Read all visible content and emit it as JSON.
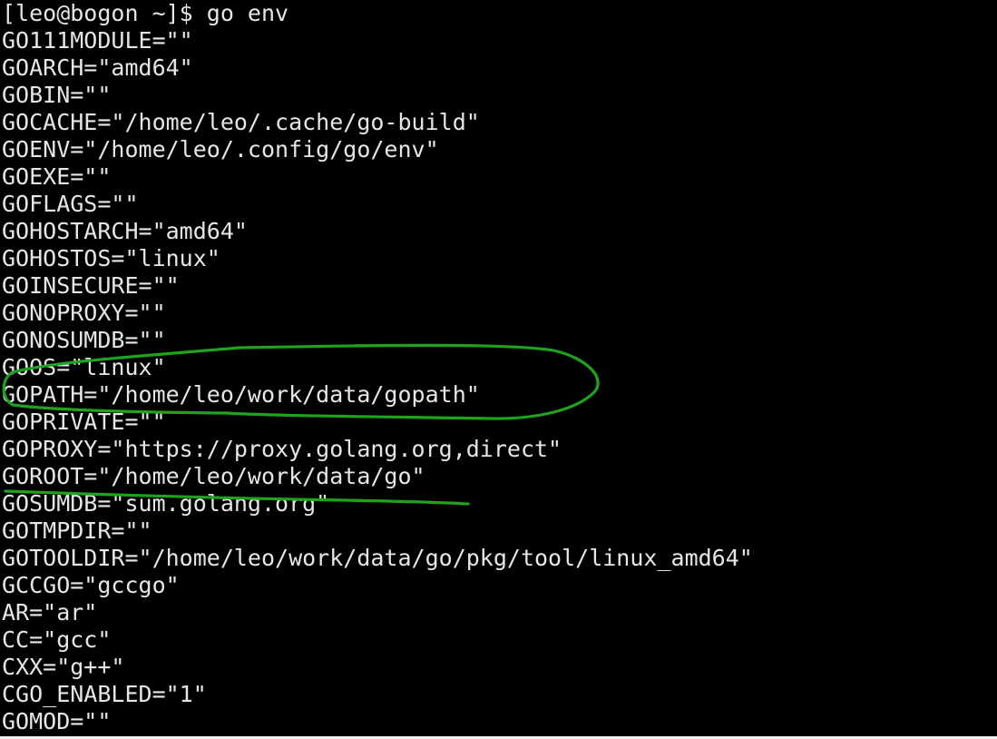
{
  "terminal": {
    "prompt": "[leo@bogon ~]$ go env",
    "lines": [
      "GO111MODULE=\"\"",
      "GOARCH=\"amd64\"",
      "GOBIN=\"\"",
      "GOCACHE=\"/home/leo/.cache/go-build\"",
      "GOENV=\"/home/leo/.config/go/env\"",
      "GOEXE=\"\"",
      "GOFLAGS=\"\"",
      "GOHOSTARCH=\"amd64\"",
      "GOHOSTOS=\"linux\"",
      "GOINSECURE=\"\"",
      "GONOPROXY=\"\"",
      "GONOSUMDB=\"\"",
      "GOOS=\"linux\"",
      "GOPATH=\"/home/leo/work/data/gopath\"",
      "GOPRIVATE=\"\"",
      "GOPROXY=\"https://proxy.golang.org,direct\"",
      "GOROOT=\"/home/leo/work/data/go\"",
      "GOSUMDB=\"sum.golang.org\"",
      "GOTMPDIR=\"\"",
      "GOTOOLDIR=\"/home/leo/work/data/go/pkg/tool/linux_amd64\"",
      "GCCGO=\"gccgo\"",
      "AR=\"ar\"",
      "CC=\"gcc\"",
      "CXX=\"g++\"",
      "CGO_ENABLED=\"1\"",
      "GOMOD=\"\""
    ]
  },
  "colors": {
    "background": "#000000",
    "text": "#e6e6e6",
    "annotation": "#1fa31f"
  }
}
